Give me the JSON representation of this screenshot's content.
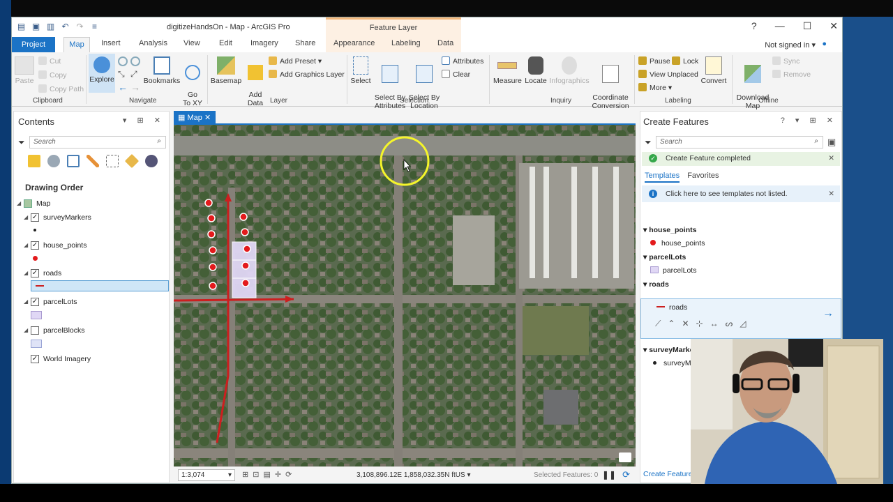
{
  "titlebar": {
    "app_title": "digitizeHandsOn - Map - ArcGIS Pro",
    "context_tab": "Feature Layer",
    "help": "?"
  },
  "tabs": {
    "project": "Project",
    "active": "Map",
    "items": [
      "Insert",
      "Analysis",
      "View",
      "Edit",
      "Imagery",
      "Share",
      "Appearance",
      "Labeling",
      "Data"
    ],
    "sign_in": "Not signed in"
  },
  "ribbon": {
    "clipboard": {
      "label": "Clipboard",
      "paste": "Paste",
      "cut": "Cut",
      "copy": "Copy",
      "copy_path": "Copy Path"
    },
    "navigate": {
      "label": "Navigate",
      "explore": "Explore",
      "bookmarks": "Bookmarks",
      "goto_xy": "Go\nTo XY"
    },
    "layer": {
      "label": "Layer",
      "basemap": "Basemap",
      "add_data": "Add\nData",
      "add_preset": "Add Preset",
      "add_graphics_layer": "Add Graphics Layer"
    },
    "selection": {
      "label": "Selection",
      "select": "Select",
      "select_by_attributes": "Select By\nAttributes",
      "select_by_location": "Select By\nLocation",
      "attributes": "Attributes",
      "clear": "Clear"
    },
    "inquiry": {
      "label": "Inquiry",
      "measure": "Measure",
      "locate": "Locate",
      "infographics": "Infographics",
      "coordinate_conversion": "Coordinate\nConversion"
    },
    "labeling": {
      "label": "Labeling",
      "pause": "Pause",
      "lock": "Lock",
      "view_unplaced": "View Unplaced",
      "more": "More",
      "convert": "Convert"
    },
    "offline": {
      "label": "Offline",
      "download_map": "Download\nMap",
      "sync": "Sync",
      "remove": "Remove"
    }
  },
  "contents": {
    "title": "Contents",
    "search_placeholder": "Search",
    "drawing_order": "Drawing Order",
    "layers": [
      {
        "name": "Map"
      },
      {
        "name": "surveyMarkers",
        "checked": true
      },
      {
        "name": "house_points",
        "checked": true
      },
      {
        "name": "roads",
        "checked": true
      },
      {
        "name": "parcelLots",
        "checked": true
      },
      {
        "name": "parcelBlocks",
        "checked": false
      },
      {
        "name": "World Imagery",
        "checked": true
      }
    ]
  },
  "map": {
    "tab": "Map",
    "scale": "1:3,074",
    "coordinates": "3,108,896.12E 1,858,032.35N ftUS",
    "selected_features": "Selected Features: 0"
  },
  "create_features": {
    "title": "Create Features",
    "search_placeholder": "Search",
    "banner": "Create Feature completed",
    "tab_templates": "Templates",
    "tab_favorites": "Favorites",
    "info": "Click here to see templates not listed.",
    "groups": [
      {
        "name": "house_points",
        "template": "house_points"
      },
      {
        "name": "parcelLots",
        "template": "parcelLots"
      },
      {
        "name": "roads",
        "template": "roads"
      },
      {
        "name": "surveyMarkers",
        "template": "surveyMa"
      }
    ],
    "footer": "Create Features"
  },
  "colors": {
    "accent": "#1b73c6",
    "point": "#e31a1c",
    "parcel_fill": "#e0d7f5",
    "road": "#cc1f1f"
  }
}
